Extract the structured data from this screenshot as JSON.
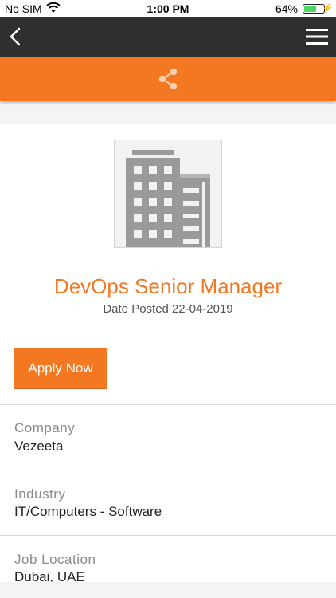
{
  "status_bar": {
    "carrier": "No SIM",
    "time": "1:00 PM",
    "battery_percent": "64%",
    "battery_level": 0.64,
    "battery_color": "#4cd964"
  },
  "nav": {
    "back_icon": "chevron-left-icon",
    "menu_icon": "hamburger-menu-icon",
    "background": "#2f2f2f"
  },
  "share_bar": {
    "icon": "share-icon",
    "accent": "#f47721"
  },
  "job": {
    "title": "DevOps Senior Manager",
    "date_label": "Date Posted",
    "date_value": "22-04-2019",
    "logo_icon": "building-icon",
    "apply_label": "Apply Now"
  },
  "details": [
    {
      "label": "Company",
      "value": "Vezeeta"
    },
    {
      "label": "Industry",
      "value": "IT/Computers - Software"
    },
    {
      "label": "Job Location",
      "value": "Dubai, UAE"
    }
  ]
}
